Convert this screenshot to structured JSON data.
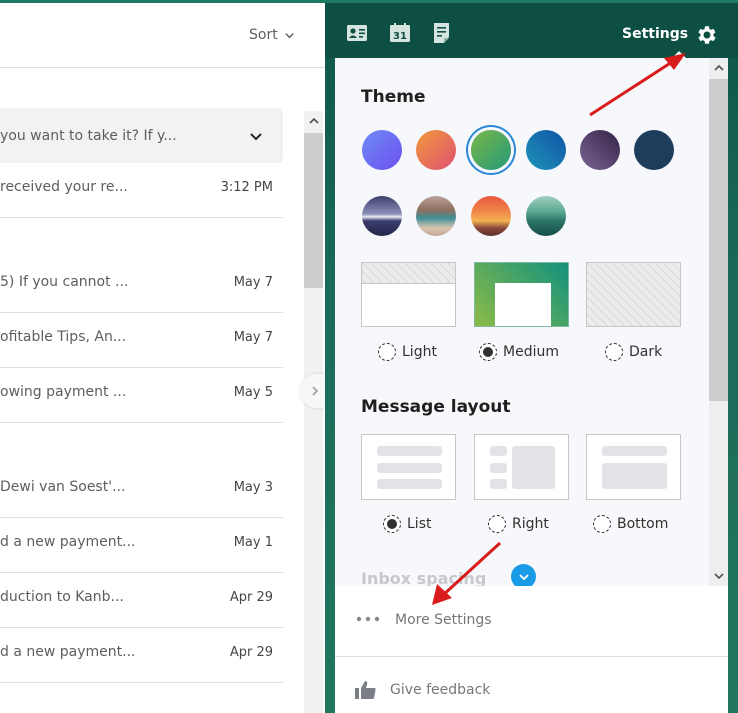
{
  "mail_list": {
    "sort_label": "Sort",
    "expanded_preview": "you want to take it? If y...",
    "rows": [
      {
        "snippet": "received your re...",
        "date": "3:12 PM"
      },
      {
        "snippet": "5) If you cannot ...",
        "date": "May 7"
      },
      {
        "snippet": "ofitable Tips, An...",
        "date": "May 7"
      },
      {
        "snippet": "owing payment ...",
        "date": "May 5"
      },
      {
        "snippet": "Dewi van Soest'...",
        "date": "May 3"
      },
      {
        "snippet": "d a new payment...",
        "date": "May 1"
      },
      {
        "snippet": "duction to Kanb...",
        "date": "Apr 29"
      },
      {
        "snippet": "d a new payment...",
        "date": "Apr 29"
      }
    ]
  },
  "topbar": {
    "icons": [
      "contacts-icon",
      "calendar-icon",
      "tasks-icon"
    ],
    "calendar_day": "31",
    "settings_label": "Settings"
  },
  "settings": {
    "theme_heading": "Theme",
    "themes": [
      {
        "name": "purple",
        "selected": false
      },
      {
        "name": "orange",
        "selected": false
      },
      {
        "name": "green",
        "selected": true
      },
      {
        "name": "blue",
        "selected": false
      },
      {
        "name": "plum",
        "selected": false
      },
      {
        "name": "navy",
        "selected": false
      },
      {
        "name": "mountains",
        "selected": false
      },
      {
        "name": "camper",
        "selected": false
      },
      {
        "name": "sunset",
        "selected": false
      },
      {
        "name": "lake",
        "selected": false
      }
    ],
    "mode_options": [
      {
        "label": "Light",
        "selected": false
      },
      {
        "label": "Medium",
        "selected": true
      },
      {
        "label": "Dark",
        "selected": false
      }
    ],
    "layout_heading": "Message layout",
    "layout_options": [
      {
        "label": "List",
        "selected": true
      },
      {
        "label": "Right",
        "selected": false
      },
      {
        "label": "Bottom",
        "selected": false
      }
    ],
    "inbox_spacing_heading": "Inbox spacing",
    "more_settings_label": "More Settings",
    "feedback_label": "Give feedback"
  },
  "colors": {
    "accent": "#2b88d8",
    "topbar": "#0e4f43",
    "annotation_arrow": "#d81b1b"
  }
}
